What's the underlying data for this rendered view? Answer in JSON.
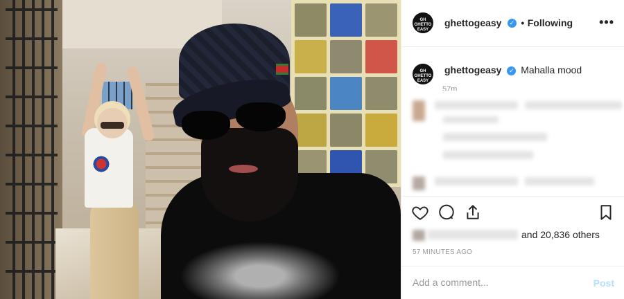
{
  "post": {
    "author": {
      "username": "ghettogeasy",
      "avatar_text": "GH GHETTO EASY",
      "verified_icon": "verified-badge-icon"
    },
    "follow_status": "Following",
    "separator": "•",
    "more_options": "•••",
    "caption": {
      "username": "ghettogeasy",
      "text": "Mahalla mood",
      "time_short": "57m"
    },
    "actions": {
      "like_icon": "heart-icon",
      "comment_icon": "speech-bubble-icon",
      "share_icon": "share-icon",
      "save_icon": "bookmark-icon"
    },
    "likes_text": "and 20,836 others",
    "timestamp": "57 MINUTES AGO",
    "comment_box": {
      "placeholder": "Add a comment...",
      "post_label": "Post"
    },
    "colors": {
      "verified": "#3897f0",
      "post_disabled": "#b2dffc",
      "text_primary": "#262626",
      "text_secondary": "#999999"
    }
  }
}
